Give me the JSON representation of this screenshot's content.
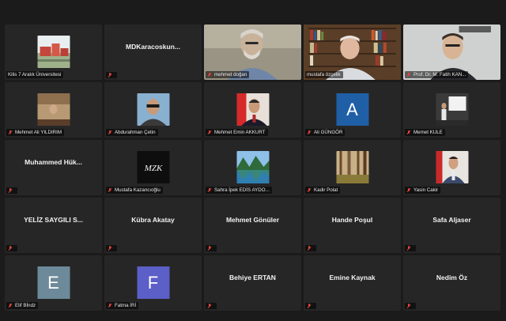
{
  "colors": {
    "active_speaker_border": "#d6e23a",
    "mic_muted": "#e0443e",
    "letter_e_bg": "#6d8a9a",
    "letter_a_bg": "#1f5fa6",
    "letter_f_bg": "#5b5fc7"
  },
  "participants": [
    {
      "name": "Kilis 7 Aralık Üniversitesi",
      "display": "picture",
      "picture": "campus-photo",
      "muted": false
    },
    {
      "name": "MDKaracoskun...",
      "display": "name",
      "muted": true
    },
    {
      "name": "mehmet doğan",
      "display": "video",
      "picture": "bearded-man-video",
      "muted": true
    },
    {
      "name": "mustafa özçelik",
      "display": "video",
      "picture": "bookshelf-man-video",
      "muted": false,
      "active_speaker": true
    },
    {
      "name": "Prof. Dr. M. Fatih KAN...",
      "display": "video",
      "picture": "man-glasses-video",
      "muted": true
    },
    {
      "name": "Mehmet Ali YILDIRIM",
      "display": "picture",
      "picture": "office-photo",
      "muted": true
    },
    {
      "name": "Abdurahman Çetin",
      "display": "picture",
      "picture": "man-sunglasses-photo",
      "muted": true
    },
    {
      "name": "Mehmet Emin AKKURT",
      "display": "picture",
      "picture": "man-flag-photo",
      "muted": true
    },
    {
      "name": "Ali GÜNGÖR",
      "display": "letter",
      "letter": "A",
      "muted": true
    },
    {
      "name": "Memet KULE",
      "display": "picture",
      "picture": "presentation-photo",
      "muted": true
    },
    {
      "name": "Muhammed Hük...",
      "display": "name",
      "muted": true
    },
    {
      "name": "Mustafa Kazancıoğlu",
      "display": "picture",
      "picture": "logo-mzk",
      "logo_text": "MZK",
      "muted": true
    },
    {
      "name": "Sahra İpek EDİS AYDO...",
      "display": "picture",
      "picture": "lake-photo",
      "muted": true
    },
    {
      "name": "Kadir Polat",
      "display": "picture",
      "picture": "forest-photo",
      "muted": true
    },
    {
      "name": "Yasin Cakir",
      "display": "picture",
      "picture": "man-suit-photo",
      "muted": true
    },
    {
      "name": "YELİZ SAYGILI S...",
      "display": "name",
      "muted": true
    },
    {
      "name": "Kübra Akatay",
      "display": "name",
      "muted": true
    },
    {
      "name": "Mehmet Gönüler",
      "display": "name",
      "muted": true
    },
    {
      "name": "Hande Poşul",
      "display": "name",
      "muted": true
    },
    {
      "name": "Safa Aljaser",
      "display": "name",
      "muted": true
    },
    {
      "name": "Elif Bİndz",
      "display": "letter",
      "letter": "E",
      "muted": true
    },
    {
      "name": "Fatma İRİ",
      "display": "letter",
      "letter": "F",
      "muted": true
    },
    {
      "name": "Behiye ERTAN",
      "display": "name",
      "muted": true
    },
    {
      "name": "Emine Kaynak",
      "display": "name",
      "muted": true
    },
    {
      "name": "Nedim Öz",
      "display": "name",
      "muted": true
    }
  ]
}
